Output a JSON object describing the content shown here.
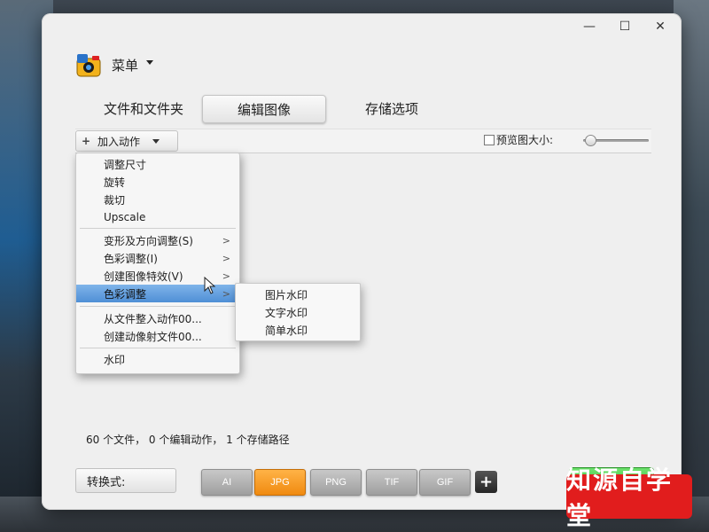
{
  "window": {
    "controls": {
      "minimize": "—",
      "maximize": "☐",
      "close": "✕"
    }
  },
  "menu": {
    "title": "菜单"
  },
  "tabs": [
    {
      "label": "文件和文件夹"
    },
    {
      "label": "编辑图像"
    },
    {
      "label": "存储选项"
    }
  ],
  "toolbar": {
    "add_action_label": "加入动作",
    "add_action_icon": "+",
    "preview_label": "预览图大小:"
  },
  "dropdown": {
    "items": [
      {
        "label": "调整尺寸"
      },
      {
        "label": "旋转"
      },
      {
        "label": "裁切"
      },
      {
        "label": "Upscale"
      },
      {
        "label": "变形及方向调整(S)",
        "arrow": ">"
      },
      {
        "label": "色彩调整(I)",
        "arrow": ">"
      },
      {
        "label": "创建图像特效(V)",
        "arrow": ">"
      },
      {
        "label": "色彩调整",
        "arrow": ">"
      },
      {
        "label": "从文件整入动作00..."
      },
      {
        "label": "创建动像射文件00..."
      },
      {
        "label": "水印"
      }
    ]
  },
  "submenu": {
    "items": [
      {
        "label": "图片水印"
      },
      {
        "label": "文字水印"
      },
      {
        "label": "简单水印"
      }
    ]
  },
  "status": {
    "text": "60 个文件， 0 个编辑动作， 1 个存储路径"
  },
  "bottom": {
    "convert_label": "转换式:",
    "formats": [
      "AI",
      "JPG",
      "PNG",
      "TIF",
      "GIF"
    ],
    "active_format": "JPG",
    "add_format": "+"
  },
  "watermark": {
    "text": "知源自学堂"
  },
  "colors": {
    "accent": "#f08a10",
    "highlight": "#4f8fd6",
    "go": "#2fae2f",
    "watermark_bg": "#e11d1d"
  }
}
